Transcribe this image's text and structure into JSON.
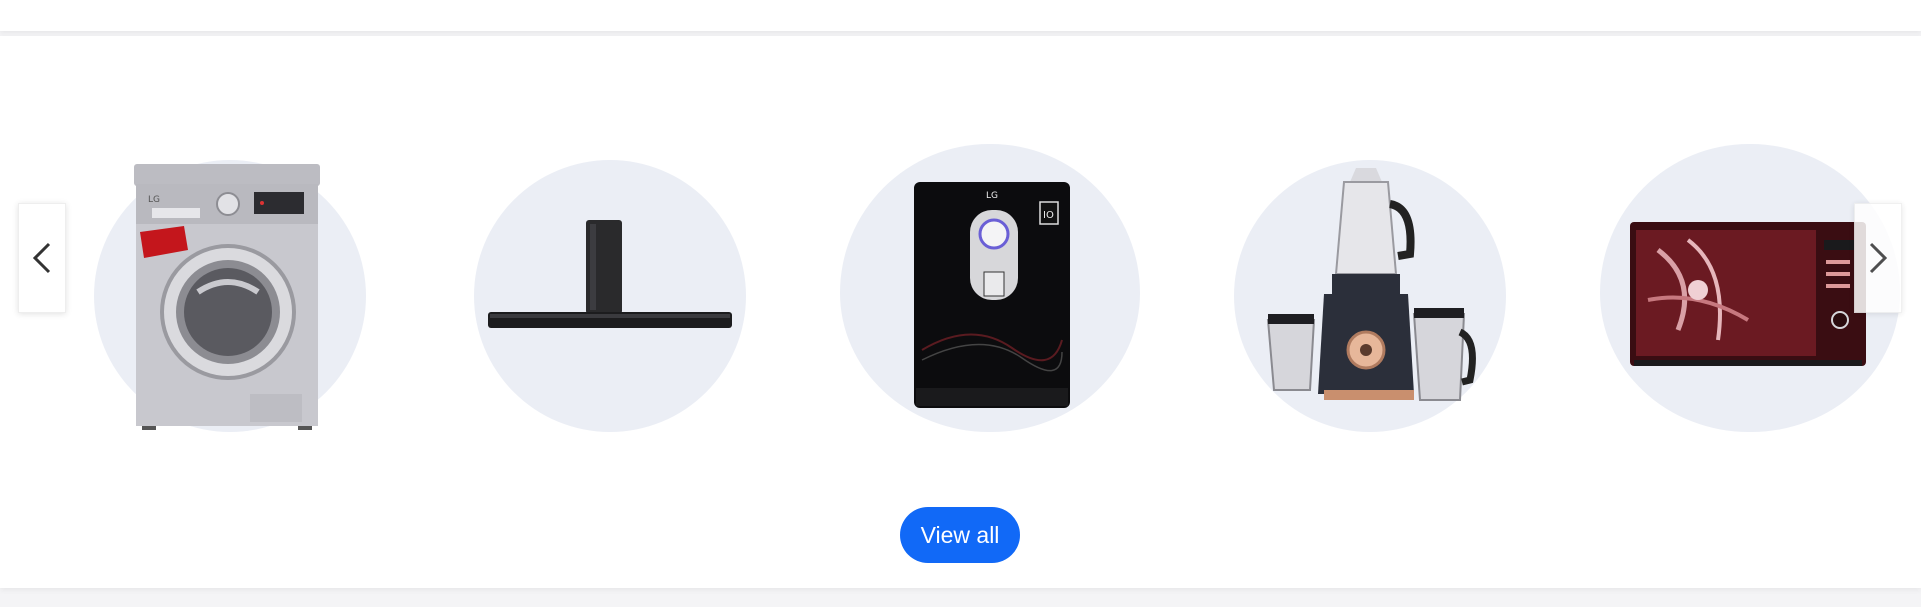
{
  "header": {},
  "carousel": {
    "items": [
      {
        "icon": "washing-machine-icon"
      },
      {
        "icon": "soundbar-icon"
      },
      {
        "icon": "water-purifier-icon"
      },
      {
        "icon": "mixer-grinder-icon"
      },
      {
        "icon": "microwave-oven-icon"
      }
    ],
    "prev_icon": "chevron-left-icon",
    "next_icon": "chevron-right-icon",
    "view_all_label": "View all"
  },
  "colors": {
    "accent": "#1169f7",
    "circle_bg": "#ebeef5",
    "card_bg": "#ffffff",
    "page_bg": "#f4f4f6"
  }
}
